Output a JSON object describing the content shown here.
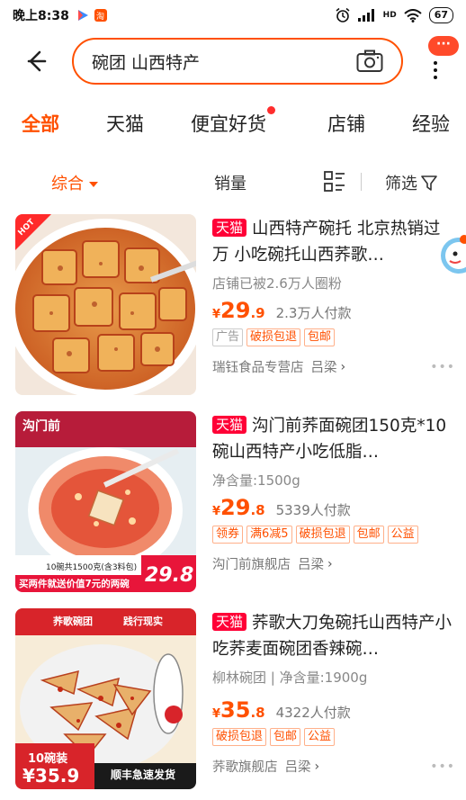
{
  "status": {
    "time": "晚上8:38",
    "battery": "67",
    "hd": "HD"
  },
  "search": {
    "query": "碗团 山西特产",
    "menu_badge": "···"
  },
  "tabs": [
    {
      "label": "全部"
    },
    {
      "label": "天猫"
    },
    {
      "label": "便宜好货"
    },
    {
      "label": "店铺"
    },
    {
      "label": "经验"
    }
  ],
  "sort": {
    "comprehensive": "综合",
    "sales": "销量",
    "filter": "筛选"
  },
  "products": [
    {
      "tag": "天猫",
      "title": "山西特产碗托 北京热销过万 小吃碗托山西荞歌…",
      "sub": "店铺已被2.6万人圈粉",
      "price_cur": "¥",
      "price_int": "29",
      "price_dec": ".9",
      "buyers": "2.3万人付款",
      "badges": [
        "广告",
        "破损包退",
        "包邮"
      ],
      "shop": "瑞钰食品专营店",
      "location": "吕梁",
      "thumb_corner": "HOT"
    },
    {
      "tag": "天猫",
      "title": "沟门前荞面碗团150克*10碗山西特产小吃低脂…",
      "sub": "净含量:1500g",
      "price_cur": "¥",
      "price_int": "29",
      "price_dec": ".8",
      "buyers": "5339人付款",
      "badges": [
        "领券",
        "满6减5",
        "破损包退",
        "包邮",
        "公益"
      ],
      "shop": "沟门前旗舰店",
      "location": "吕梁",
      "thumb_brand": "沟门前",
      "thumb_banner": "10碗共1500克(含3料包)",
      "thumb_strip": "买两件就送价值7元的两碗",
      "thumb_price": "29.8"
    },
    {
      "tag": "天猫",
      "title": "荞歌大刀兔碗托山西特产小吃荞麦面碗团香辣碗…",
      "sub": "柳林碗团 | 净含量:1900g",
      "price_cur": "¥",
      "price_int": "35",
      "price_dec": ".8",
      "buyers": "4322人付款",
      "badges": [
        "破损包退",
        "包邮",
        "公益"
      ],
      "shop": "荞歌旗舰店",
      "location": "吕梁",
      "thumb_brand": "荞歌碗团",
      "thumb_slogan": "践行现实",
      "thumb_count": "10碗装",
      "thumb_price": "¥35.9",
      "thumb_express": "顺丰急速发货"
    }
  ],
  "colors": {
    "accent": "#ff5000",
    "tmall": "#ff0036"
  }
}
